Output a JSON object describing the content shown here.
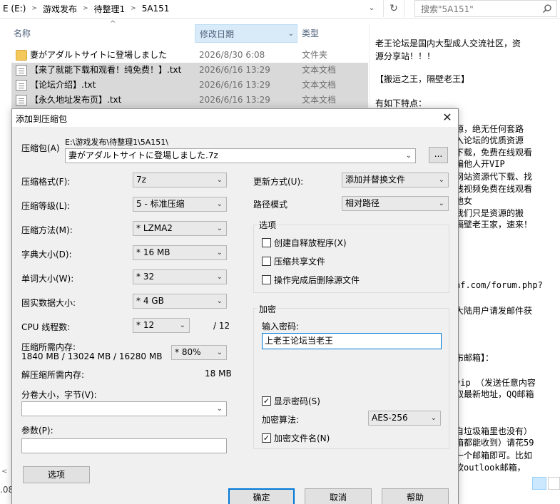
{
  "explorer": {
    "breadcrumb": [
      "E (E:)",
      "游戏发布",
      "待整理1",
      "5A151"
    ],
    "search_placeholder": "搜索\"5A151\"",
    "columns": {
      "name": "名称",
      "date": "修改日期",
      "type": "类型"
    },
    "files": [
      {
        "name": "妻がアダルトサイトに登場しました",
        "date": "2026/8/30 6:08",
        "type": "文件夹",
        "kind": "folder",
        "selected": false
      },
      {
        "name": "【来了就能下载和观看！纯免费！】.txt",
        "date": "2026/6/16 13:29",
        "type": "文本文档",
        "kind": "txt",
        "selected": true
      },
      {
        "name": "【论坛介绍】.txt",
        "date": "2026/6/16 13:29",
        "type": "文本文档",
        "kind": "txt",
        "selected": true
      },
      {
        "name": "【永久地址发布页】.txt",
        "date": "2026/6/16 13:29",
        "type": "文本文档",
        "kind": "txt",
        "selected": true
      }
    ],
    "status_partial": ".08"
  },
  "preview": {
    "lines": [
      "老王论坛是国内大型成人交流社区，资",
      "源分享站！！！",
      "",
      "【搬运之王，隔壁老王】",
      "",
      "有如下特点：",
      "源，绝无任何套路",
      "入论坛的优质资源",
      "下载，免费在线观看",
      "骗他人开VIP",
      "网站资源代下载、找",
      "线视频免费在线观看",
      "他女",
      "  我们只是资源的搬",
      "隔壁老王家，速来！",
      "",
      "",
      "",
      "nf.com/forum.php?",
      "",
      "大陆用户请发邮件获",
      "",
      "",
      "布邮箱】：",
      "",
      "vip  （发送任意内容",
      "取最新地址，QQ邮箱",
      "",
      "",
      "自垃圾箱里也没有）",
      "箱都能收到）请花59",
      "一个邮箱即可。比如",
      "软outlook邮箱，"
    ]
  },
  "dialog": {
    "title": "添加到压缩包",
    "archive_label": "压缩包(A)",
    "archive_path": "E:\\游戏发布\\待整理1\\5A151\\",
    "archive_name": "妻がアダルトサイトに登場しました.7z",
    "browse_label": "...",
    "format_label": "压缩格式(F):",
    "format_value": "7z",
    "level_label": "压缩等级(L):",
    "level_value": "5 - 标准压缩",
    "method_label": "压缩方法(M):",
    "method_value": "* LZMA2",
    "dict_label": "字典大小(D):",
    "dict_value": "* 16 MB",
    "word_label": "单词大小(W):",
    "word_value": "* 32",
    "solid_label": "固实数据大小:",
    "solid_value": "* 4 GB",
    "cpu_label": "CPU 线程数:",
    "cpu_value": "* 12",
    "cpu_total": "/ 12",
    "mem_comp_label": "压缩所需内存:",
    "mem_comp_detail": "1840 MB / 13024 MB / 16280 MB",
    "mem_comp_value": "* 80%",
    "mem_decomp_label": "解压缩所需内存:",
    "mem_decomp_value": "18 MB",
    "split_label": "分卷大小，字节(V):",
    "params_label": "参数(P):",
    "options_btn": "选项",
    "update_label": "更新方式(U):",
    "update_value": "添加并替换文件",
    "path_label": "路径模式",
    "path_value": "相对路径",
    "options_group": "选项",
    "opt_sfx": "创建自释放程序(X)",
    "opt_shared": "压缩共享文件",
    "opt_delete": "操作完成后删除源文件",
    "encrypt_group": "加密",
    "password_label": "输入密码:",
    "password_value": "上老王论坛当老王",
    "show_password": "显示密码(S)",
    "algo_label": "加密算法:",
    "algo_value": "AES-256",
    "encrypt_names": "加密文件名(N)",
    "ok": "确定",
    "cancel": "取消",
    "help": "帮助"
  }
}
